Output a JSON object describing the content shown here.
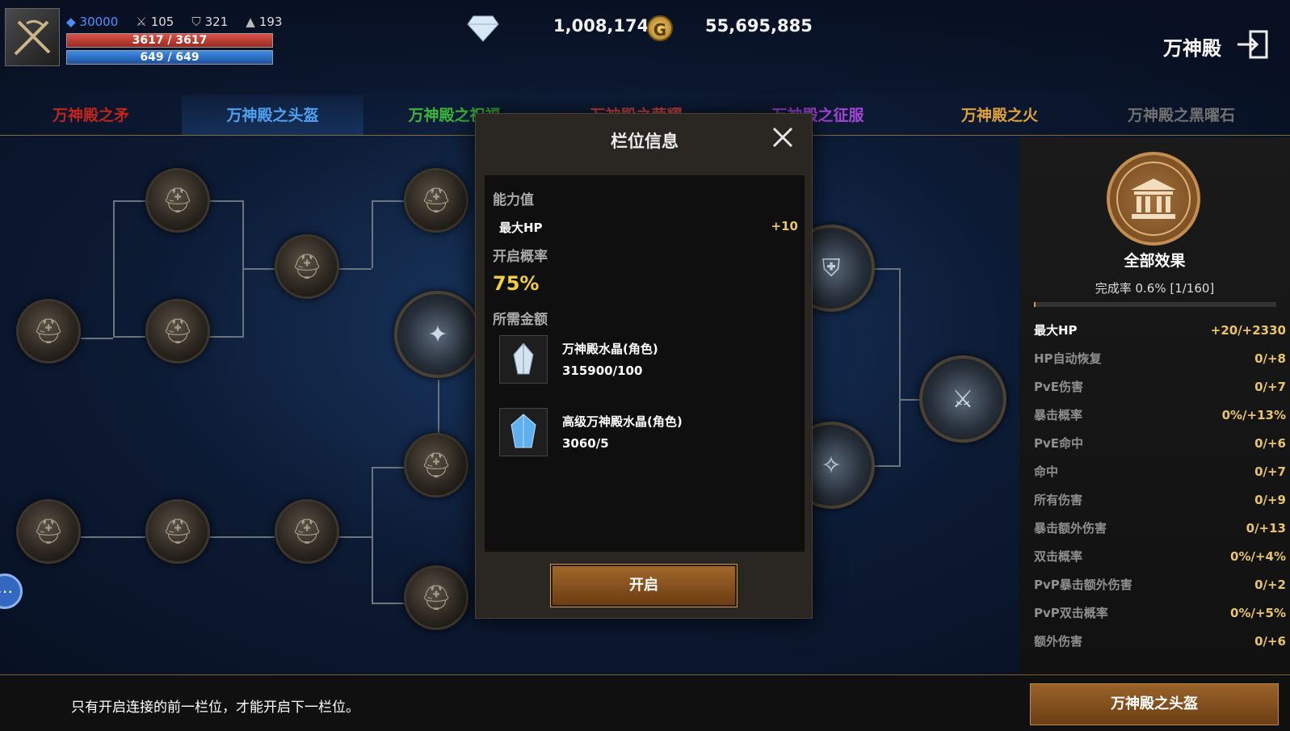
{
  "player": {
    "level": "30000",
    "attack": "105",
    "defense": "321",
    "magic": "193",
    "hp": "3617 / 3617",
    "mp": "649 / 649"
  },
  "currency": {
    "diamonds": "1,008,174",
    "gold_symbol": "G",
    "gold": "55,695,885"
  },
  "header": {
    "title": "万神殿"
  },
  "tabs": [
    {
      "label": "万神殿之矛",
      "color": "#c0251b"
    },
    {
      "label": "万神殿之头盔",
      "color": "#4ea0f0"
    },
    {
      "label": "万神殿之祝福",
      "color": "#3bb53b"
    },
    {
      "label": "万神殿之荣耀",
      "color": "#d94a4a"
    },
    {
      "label": "万神殿之征服",
      "color": "#a646d9"
    },
    {
      "label": "万神殿之火",
      "color": "#e0a23a"
    },
    {
      "label": "万神殿之黑曜石",
      "color": "#707070"
    }
  ],
  "side_panel": {
    "title": "全部效果",
    "completion": "完成率 0.6% [1/160]",
    "completion_fraction": 0.006,
    "effects": [
      {
        "name": "最大HP",
        "value": "+20/+2330"
      },
      {
        "name": "HP自动恢复",
        "value": "0/+8"
      },
      {
        "name": "PvE伤害",
        "value": "0/+7"
      },
      {
        "name": "暴击概率",
        "value": "0%/+13%"
      },
      {
        "name": "PvE命中",
        "value": "0/+6"
      },
      {
        "name": "命中",
        "value": "0/+7"
      },
      {
        "name": "所有伤害",
        "value": "0/+9"
      },
      {
        "name": "暴击额外伤害",
        "value": "0/+13"
      },
      {
        "name": "双击概率",
        "value": "0%/+4%"
      },
      {
        "name": "PvP暴击额外伤害",
        "value": "0/+2"
      },
      {
        "name": "PvP双击概率",
        "value": "0%/+5%"
      },
      {
        "name": "额外伤害",
        "value": "0/+6"
      }
    ]
  },
  "modal": {
    "title": "栏位信息",
    "ability_label": "能力值",
    "stat_name": "最大HP",
    "stat_value": "+10",
    "chance_label": "开启概率",
    "chance_value": "75%",
    "cost_label": "所需金额",
    "items": [
      {
        "name": "万神殿水晶(角色)",
        "count": "315900/100"
      },
      {
        "name": "高级万神殿水晶(角色)",
        "count": "3060/5"
      }
    ],
    "open_button": "开启"
  },
  "footer": {
    "hint": "只有开启连接的前一栏位，才能开启下一栏位。",
    "button": "万神殿之头盔"
  }
}
